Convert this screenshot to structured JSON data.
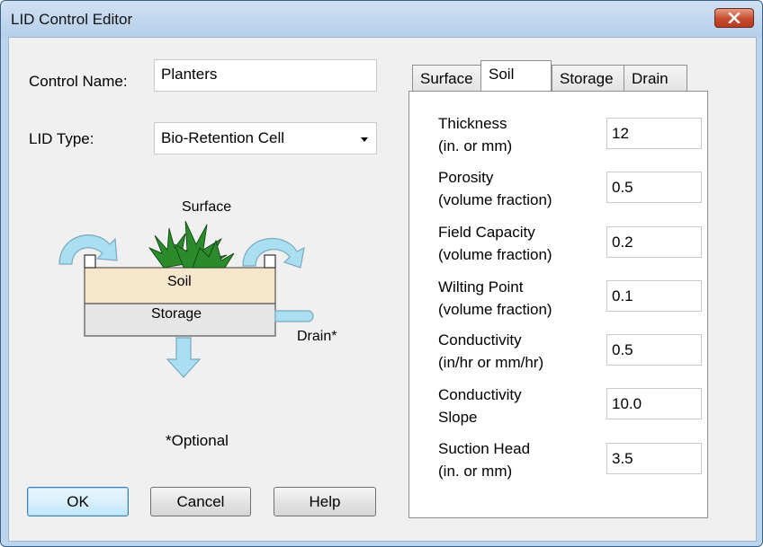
{
  "window": {
    "title": "LID Control Editor",
    "close_icon": "close-icon"
  },
  "form": {
    "control_name_label": "Control Name:",
    "control_name_value": "Planters",
    "lid_type_label": "LID Type:",
    "lid_type_value": "Bio-Retention Cell"
  },
  "diagram": {
    "surface": "Surface",
    "soil": "Soil",
    "storage": "Storage",
    "drain": "Drain*",
    "optional": "*Optional"
  },
  "buttons": {
    "ok": "OK",
    "cancel": "Cancel",
    "help": "Help"
  },
  "tabs": [
    {
      "label": "Surface",
      "active": false
    },
    {
      "label": "Soil",
      "active": true
    },
    {
      "label": "Storage",
      "active": false
    },
    {
      "label": "Drain",
      "active": false
    }
  ],
  "soil_params": [
    {
      "line1": "Thickness",
      "line2": "(in. or mm)",
      "value": "12"
    },
    {
      "line1": "Porosity",
      "line2": "(volume fraction)",
      "value": "0.5"
    },
    {
      "line1": "Field Capacity",
      "line2": "(volume fraction)",
      "value": "0.2"
    },
    {
      "line1": "Wilting Point",
      "line2": "(volume fraction)",
      "value": "0.1"
    },
    {
      "line1": "Conductivity",
      "line2": "(in/hr or mm/hr)",
      "value": "0.5"
    },
    {
      "line1": "Conductivity",
      "line2": "Slope",
      "value": "10.0"
    },
    {
      "line1": "Suction Head",
      "line2": "(in. or mm)",
      "value": "3.5"
    }
  ],
  "colors": {
    "title_bar": "#bcd5ee",
    "close_button": "#c64b2f",
    "arrow_fill": "#a9dff0",
    "soil_fill": "#f6e6cc",
    "storage_fill": "#e6e6e6",
    "plant_green": "#2b8a2b"
  }
}
